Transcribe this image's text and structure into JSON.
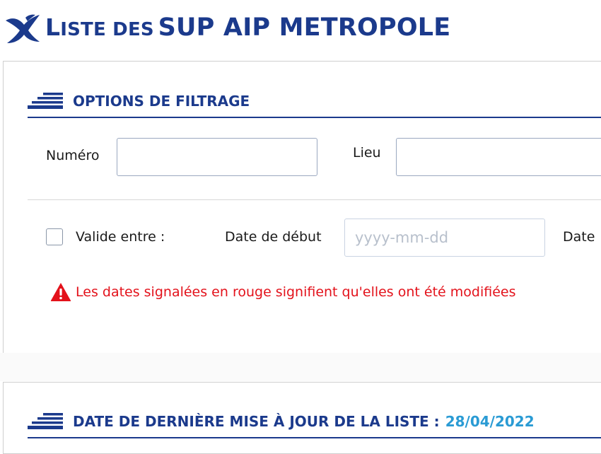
{
  "header": {
    "title_first_letter": "L",
    "title_rest_small_caps": "ISTE DES",
    "title_main": "SUP AIP METROPOLE"
  },
  "filter": {
    "section_title": "OPTIONS DE FILTRAGE",
    "numero_label": "Numéro",
    "numero_value": "",
    "lieu_label": "Lieu",
    "lieu_value": "",
    "valid_label": "Valide entre :",
    "valid_checked": false,
    "start_date_label": "Date de début",
    "start_date_placeholder": "yyyy-mm-dd",
    "end_date_label_partial": "Date",
    "warning_text": "Les dates signalées en rouge signifient qu'elles ont été modifiées"
  },
  "update": {
    "label": "DATE DE DERNIÈRE MISE À JOUR DE LA LISTE :",
    "date": "28/04/2022"
  },
  "icons": {
    "logo": "bird-logo-icon",
    "section": "stack-lines-icon",
    "calendar": "calendar-icon",
    "warning": "warning-triangle-icon"
  },
  "colors": {
    "brand_blue": "#1b3a8c",
    "date_blue": "#2a9bd4",
    "warning_red": "#e3121b",
    "calendar_gray": "#c3cbd6"
  }
}
